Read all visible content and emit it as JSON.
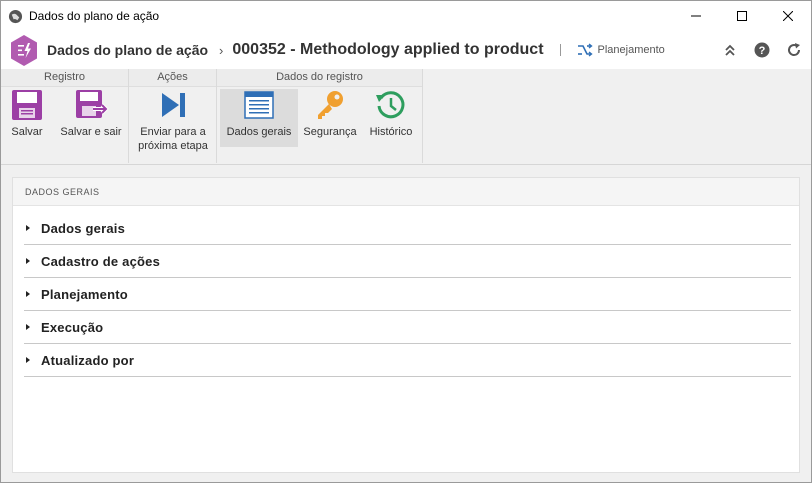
{
  "window": {
    "title": "Dados do plano de ação"
  },
  "header": {
    "breadcrumb": "Dados do plano de ação",
    "record_title": "000352 - Methodology applied to product",
    "planning_label": "Planejamento"
  },
  "ribbon": {
    "groups": [
      {
        "label": "Registro"
      },
      {
        "label": "Ações"
      },
      {
        "label": "Dados do registro"
      }
    ],
    "buttons": {
      "save": "Salvar",
      "save_exit": "Salvar e sair",
      "send_next_1": "Enviar para a",
      "send_next_2": "próxima etapa",
      "general_data": "Dados gerais",
      "security": "Segurança",
      "history": "Histórico"
    }
  },
  "panel": {
    "heading": "DADOS GERAIS",
    "sections": [
      {
        "label": "Dados gerais"
      },
      {
        "label": "Cadastro de ações"
      },
      {
        "label": "Planejamento"
      },
      {
        "label": "Execução"
      },
      {
        "label": "Atualizado por"
      }
    ]
  },
  "colors": {
    "accent_purple": "#9c3fa5",
    "logo_hex": "#b15bb0",
    "nav_blue": "#2f6fb6",
    "key_orange": "#f0a030",
    "history_green": "#2e9e5e"
  },
  "icons": {
    "app": "globe-icon",
    "planning": "shuffle-icon",
    "collapse": "double-chevron-up-icon",
    "help": "help-icon",
    "refresh": "refresh-icon"
  }
}
